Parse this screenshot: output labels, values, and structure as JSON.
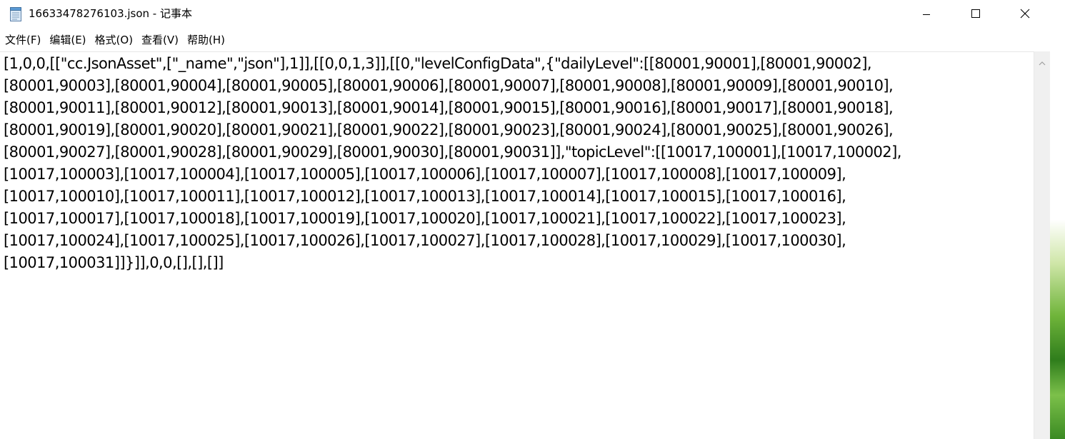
{
  "window": {
    "title": "16633478276103.json - 记事本",
    "icon": "notepad-icon",
    "controls": {
      "minimize": "minimize-icon",
      "maximize": "maximize-icon",
      "close": "close-icon"
    }
  },
  "menu": [
    {
      "label": "文件(F)"
    },
    {
      "label": "编辑(E)"
    },
    {
      "label": "格式(O)"
    },
    {
      "label": "查看(V)"
    },
    {
      "label": "帮助(H)"
    }
  ],
  "content": {
    "lines": [
      "[1,0,0,[[\"cc.JsonAsset\",[\"_name\",\"json\"],1]],[[0,0,1,3]],[[0,\"levelConfigData\",{\"dailyLevel\":[[80001,90001],[80001,90002],",
      "[80001,90003],[80001,90004],[80001,90005],[80001,90006],[80001,90007],[80001,90008],[80001,90009],[80001,90010],",
      "[80001,90011],[80001,90012],[80001,90013],[80001,90014],[80001,90015],[80001,90016],[80001,90017],[80001,90018],",
      "[80001,90019],[80001,90020],[80001,90021],[80001,90022],[80001,90023],[80001,90024],[80001,90025],[80001,90026],",
      "[80001,90027],[80001,90028],[80001,90029],[80001,90030],[80001,90031]],\"topicLevel\":[[10017,100001],[10017,100002],",
      "[10017,100003],[10017,100004],[10017,100005],[10017,100006],[10017,100007],[10017,100008],[10017,100009],",
      "[10017,100010],[10017,100011],[10017,100012],[10017,100013],[10017,100014],[10017,100015],[10017,100016],",
      "[10017,100017],[10017,100018],[10017,100019],[10017,100020],[10017,100021],[10017,100022],[10017,100023],",
      "[10017,100024],[10017,100025],[10017,100026],[10017,100027],[10017,100028],[10017,100029],[10017,100030],",
      "[10017,100031]]}]],0,0,[],[],[]]"
    ]
  },
  "scrollbar": {
    "up_icon": "scroll-up-arrow-icon"
  }
}
